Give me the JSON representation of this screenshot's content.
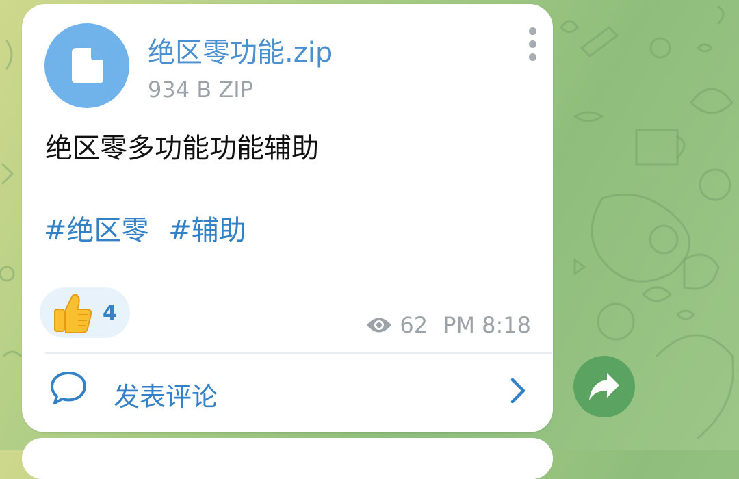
{
  "post": {
    "file": {
      "name": "绝区零功能.zip",
      "meta": "934 B ZIP",
      "icon": "file-icon"
    },
    "caption": "绝区零多功能功能辅助",
    "hashtags": [
      "#绝区零",
      "#辅助"
    ],
    "reaction": {
      "emoji": "thumbs-up-icon",
      "count": "4"
    },
    "views": "62",
    "time": "PM 8:18",
    "comments_label": "发表评论"
  },
  "colors": {
    "accent": "#3381c6",
    "file_circle": "#6fb3ea",
    "share_button": "#5aa361",
    "muted": "#9ca3a8"
  }
}
